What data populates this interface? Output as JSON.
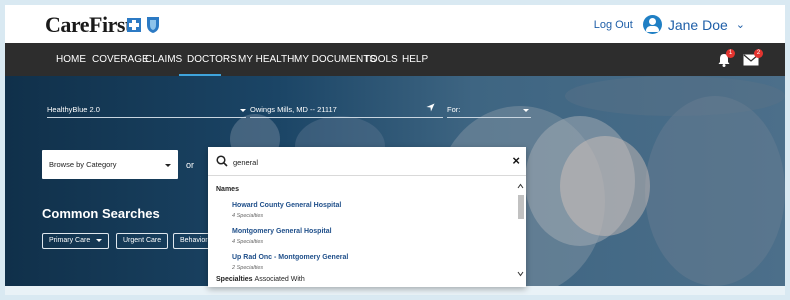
{
  "header": {
    "logo_text": "CareFirst.",
    "logout": "Log Out",
    "user_name": "Jane Doe",
    "chevron": "⌄"
  },
  "nav": {
    "items": [
      "HOME",
      "COVERAGE",
      "CLAIMS",
      "DOCTORS",
      "MY HEALTH",
      "MY DOCUMENTS",
      "TOOLS",
      "HELP"
    ],
    "active": "DOCTORS",
    "notification_count": "1",
    "message_count": "2"
  },
  "filters": {
    "plan": "HealthyBlue 2.0",
    "location": "Owings Mills, MD -- 21117",
    "for_label": "For:"
  },
  "browse": {
    "label": "Browse by Category",
    "or_text": "or"
  },
  "common_searches": {
    "title": "Common Searches",
    "chips": [
      "Primary Care",
      "Urgent Care",
      "Behavioral"
    ]
  },
  "search": {
    "value": "general",
    "close_glyph": "×",
    "names_heading": "Names",
    "results": [
      {
        "name": "Howard County General Hospital",
        "detail": "4 Specialties"
      },
      {
        "name": "Montgomery General Hospital",
        "detail": "4 Specialties"
      },
      {
        "name": "Up Rad Onc - Montgomery General",
        "detail": "2 Specialties"
      }
    ],
    "specialties_heading": "Specialties",
    "specialties_suffix": "Associated With"
  },
  "colors": {
    "nav_bg": "#2d2d2d",
    "accent": "#3fa4dc",
    "link": "#1f4f8a",
    "badge": "#e3342f"
  },
  "icons": [
    "carefirst-logo-icon",
    "user-avatar-icon",
    "chevron-down-icon",
    "bell-icon",
    "mail-icon",
    "location-arrow-icon",
    "search-icon",
    "close-icon",
    "scroll-up-icon",
    "scroll-down-icon"
  ]
}
